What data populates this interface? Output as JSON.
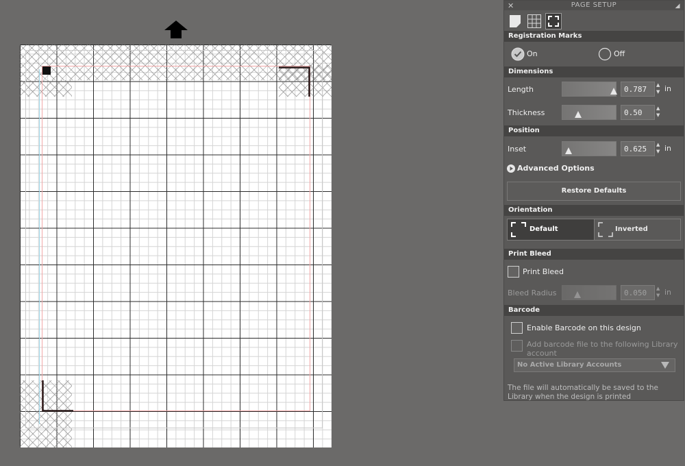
{
  "panel": {
    "title": "PAGE SETUP",
    "close_glyph": "✕",
    "resize_glyph": "◢",
    "tabs": [
      {
        "icon": "page-icon"
      },
      {
        "icon": "grid-icon"
      },
      {
        "icon": "corner-marks-icon"
      }
    ]
  },
  "registration_marks": {
    "header": "Registration Marks",
    "on_label": "On",
    "off_label": "Off",
    "selected": "On"
  },
  "dimensions": {
    "header": "Dimensions",
    "length_label": "Length",
    "length_value": "0.787",
    "length_unit": "in",
    "thickness_label": "Thickness",
    "thickness_value": "0.50"
  },
  "position": {
    "header": "Position",
    "inset_label": "Inset",
    "inset_value": "0.625",
    "inset_unit": "in",
    "advanced_label": "Advanced Options",
    "restore_label": "Restore Defaults"
  },
  "orientation": {
    "header": "Orientation",
    "default_label": "Default",
    "inverted_label": "Inverted",
    "selected": "Default"
  },
  "print_bleed": {
    "header": "Print Bleed",
    "checkbox_label": "Print Bleed",
    "radius_label": "Bleed Radius",
    "radius_value": "0.050",
    "radius_unit": "in"
  },
  "barcode": {
    "header": "Barcode",
    "enable_label": "Enable Barcode on this design",
    "add_label": "Add barcode file to the following Library account",
    "dropdown_value": "No Active Library Accounts",
    "note": "The file will automatically be saved to the Library when the design is printed"
  },
  "colors": {
    "background": "#6b6a69",
    "panel": "#5a5958",
    "section_header": "#454443",
    "mat": "#ffffff",
    "bleed_line": "#f2a7a7",
    "reg_mark": "#111111"
  }
}
